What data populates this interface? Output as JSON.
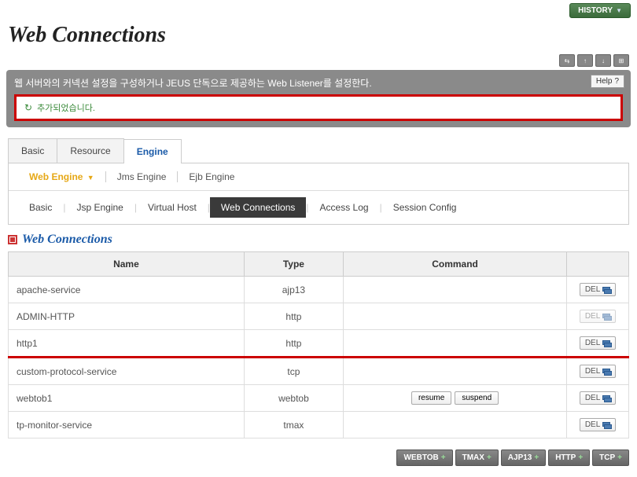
{
  "header": {
    "history_label": "HISTORY",
    "page_title": "Web Connections"
  },
  "description": {
    "text": "웹 서버와의 커넥션 설정을 구성하거나 JEUS 단독으로 제공하는 Web Listener를 설정한다.",
    "help_label": "Help"
  },
  "alert": {
    "message": "추가되었습니다."
  },
  "tabs_level1": [
    {
      "label": "Basic",
      "active": false
    },
    {
      "label": "Resource",
      "active": false
    },
    {
      "label": "Engine",
      "active": true
    }
  ],
  "tabs_level2": [
    {
      "label": "Web Engine",
      "active": true
    },
    {
      "label": "Jms Engine",
      "active": false
    },
    {
      "label": "Ejb Engine",
      "active": false
    }
  ],
  "tabs_level3": [
    {
      "label": "Basic",
      "active": false
    },
    {
      "label": "Jsp Engine",
      "active": false
    },
    {
      "label": "Virtual Host",
      "active": false
    },
    {
      "label": "Web Connections",
      "active": true
    },
    {
      "label": "Access Log",
      "active": false
    },
    {
      "label": "Session Config",
      "active": false
    }
  ],
  "section": {
    "title": "Web Connections"
  },
  "table": {
    "headers": [
      "Name",
      "Type",
      "Command",
      ""
    ],
    "rows": [
      {
        "name": "apache-service",
        "type": "ajp13",
        "commands": [],
        "del_enabled": true,
        "highlight": false
      },
      {
        "name": "ADMIN-HTTP",
        "type": "http",
        "commands": [],
        "del_enabled": false,
        "highlight": false
      },
      {
        "name": "http1",
        "type": "http",
        "commands": [],
        "del_enabled": true,
        "highlight": true
      },
      {
        "name": "custom-protocol-service",
        "type": "tcp",
        "commands": [],
        "del_enabled": true,
        "highlight": false
      },
      {
        "name": "webtob1",
        "type": "webtob",
        "commands": [
          "resume",
          "suspend"
        ],
        "del_enabled": true,
        "highlight": false
      },
      {
        "name": "tp-monitor-service",
        "type": "tmax",
        "commands": [],
        "del_enabled": true,
        "highlight": false
      }
    ],
    "del_label": "DEL"
  },
  "footer_buttons": [
    "WEBTOB",
    "TMAX",
    "AJP13",
    "HTTP",
    "TCP"
  ]
}
